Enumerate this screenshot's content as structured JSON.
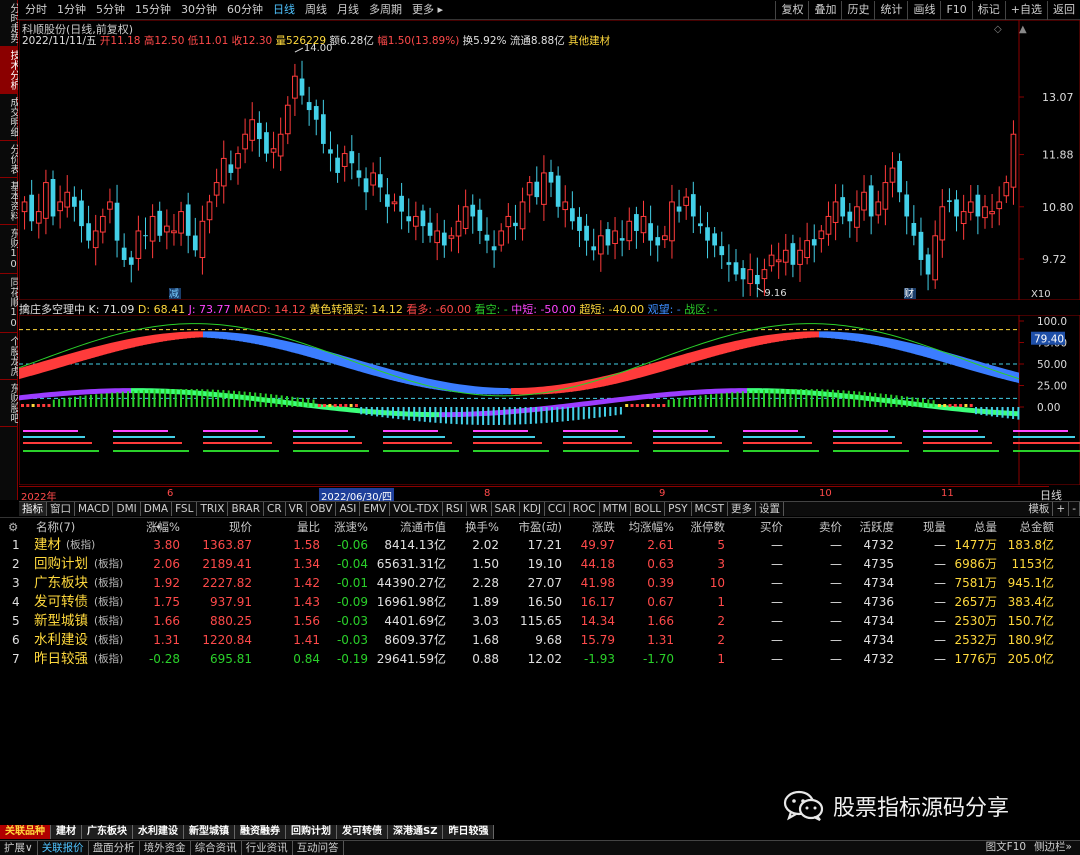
{
  "toolbar": {
    "periods": [
      "分时",
      "1分钟",
      "5分钟",
      "15分钟",
      "30分钟",
      "60分钟",
      "日线",
      "周线",
      "月线",
      "多周期",
      "更多 ▸"
    ],
    "active_period": "日线",
    "tools": [
      "复权",
      "叠加",
      "历史",
      "统计",
      "画线",
      "F10",
      "标记",
      "+自选",
      "返回"
    ]
  },
  "leftnav": [
    "分时走势",
    "技术分析",
    "成交明细",
    "分价表",
    "基本资料",
    "东财10",
    "同花顺10",
    "个股龙虎",
    "东财股吧"
  ],
  "leftnav_active": "技术分析",
  "stock": {
    "title": "科顺股份(日线,前复权)",
    "date": "2022/11/11/五",
    "open_label": "开",
    "open": "11.18",
    "high_label": "高",
    "high": "12.50",
    "low_label": "低",
    "low": "11.01",
    "close_label": "收",
    "close": "12.30",
    "volume_label": "量",
    "volume": "526229",
    "amount_label": "额",
    "amount": "6.28亿",
    "change_label": "幅",
    "change": "1.50(13.89%)",
    "turnover_label": "换",
    "turnover": "5.92%",
    "float_label": "流通",
    "float": "8.88亿",
    "sector": "其他建材"
  },
  "price_axis": [
    "13.07",
    "11.88",
    "10.80",
    "9.72"
  ],
  "price_marks": {
    "high": "14.00",
    "low": "9.16",
    "x10": "X10"
  },
  "chart_labels": {
    "jian": "减",
    "cai": "财"
  },
  "indicator": {
    "name": "擒庄多空理中",
    "k": "K: 71.09",
    "d": "D: 68.41",
    "j": "J: 73.77",
    "macd": "MACD: 14.12",
    "signal": "黄色转强买: 14.12",
    "kanduo": "看多: -60.00",
    "kankong": "看空: -",
    "zhongduan": "中短: -50.00",
    "chaoduan": "超短: -40.00",
    "guanwang": "观望: -",
    "zhanqu": "战区: -"
  },
  "ind_axis": [
    "100.0",
    "75.00",
    "50.00",
    "25.00",
    "0.00"
  ],
  "ind_current": "79.40",
  "date_axis": [
    "2022年",
    "6",
    "2022/06/30/四",
    "8",
    "9",
    "10",
    "11"
  ],
  "date_axis_right": "日线",
  "ind_tabs": [
    "指标",
    "窗口",
    "MACD",
    "DMI",
    "DMA",
    "FSL",
    "TRIX",
    "BRAR",
    "CR",
    "VR",
    "OBV",
    "ASI",
    "EMV",
    "VOL-TDX",
    "RSI",
    "WR",
    "SAR",
    "KDJ",
    "CCI",
    "ROC",
    "MTM",
    "BOLL",
    "PSY",
    "MCST",
    "更多",
    "设置"
  ],
  "ind_tabs_right": [
    "模板",
    "+",
    "-"
  ],
  "table": {
    "headers": [
      "名称(7)",
      "•",
      "涨幅%",
      "现价",
      "量比",
      "涨速%",
      "流通市值",
      "换手%",
      "市盈(动)",
      "涨跌",
      "均涨幅%",
      "涨停数",
      "买价",
      "卖价",
      "活跃度",
      "现量",
      "总量",
      "总金额"
    ],
    "rows": [
      [
        "1",
        "建材",
        "(板指)",
        "3.80",
        "1363.87",
        "1.58",
        "-0.06",
        "8414.13亿",
        "2.02",
        "17.21",
        "49.97",
        "2.61",
        "5",
        "—",
        "—",
        "4732",
        "—",
        "1477万",
        "183.8亿"
      ],
      [
        "2",
        "回购计划",
        "(板指)",
        "2.06",
        "2189.41",
        "1.34",
        "-0.04",
        "65631.31亿",
        "1.50",
        "19.10",
        "44.18",
        "0.63",
        "3",
        "—",
        "—",
        "4735",
        "—",
        "6986万",
        "1153亿"
      ],
      [
        "3",
        "广东板块",
        "(板指)",
        "1.92",
        "2227.82",
        "1.42",
        "-0.01",
        "44390.27亿",
        "2.28",
        "27.07",
        "41.98",
        "0.39",
        "10",
        "—",
        "—",
        "4734",
        "—",
        "7581万",
        "945.1亿"
      ],
      [
        "4",
        "发可转债",
        "(板指)",
        "1.75",
        "937.91",
        "1.43",
        "-0.09",
        "16961.98亿",
        "1.89",
        "16.50",
        "16.17",
        "0.67",
        "1",
        "—",
        "—",
        "4736",
        "—",
        "2657万",
        "383.4亿"
      ],
      [
        "5",
        "新型城镇",
        "(板指)",
        "1.66",
        "880.25",
        "1.56",
        "-0.03",
        "4401.69亿",
        "3.03",
        "115.65",
        "14.34",
        "1.66",
        "2",
        "—",
        "—",
        "4734",
        "—",
        "2530万",
        "150.7亿"
      ],
      [
        "6",
        "水利建设",
        "(板指)",
        "1.31",
        "1220.84",
        "1.41",
        "-0.03",
        "8609.37亿",
        "1.68",
        "9.68",
        "15.79",
        "1.31",
        "2",
        "—",
        "—",
        "4734",
        "—",
        "2532万",
        "180.9亿"
      ],
      [
        "7",
        "昨日较强",
        "(板指)",
        "-0.28",
        "695.81",
        "0.84",
        "-0.19",
        "29641.59亿",
        "0.88",
        "12.02",
        "-1.93",
        "-1.70",
        "1",
        "—",
        "—",
        "4732",
        "—",
        "1776万",
        "205.0亿"
      ]
    ]
  },
  "watermark": "股票指标源码分享",
  "block_tabs": [
    "关联品种",
    "建材",
    "广东板块",
    "水利建设",
    "新型城镇",
    "融资融券",
    "回购计划",
    "发可转债",
    "深港通SZ",
    "昨日较强"
  ],
  "status_tabs": [
    "扩展∨",
    "关联报价",
    "盘面分析",
    "境外资金",
    "综合资讯",
    "行业资讯",
    "互动问答"
  ],
  "status_right": [
    "图文F10",
    "侧边栏»"
  ],
  "colors": {
    "up": "#ff4a4a",
    "down": "#43d0e8",
    "volume": "#ffd93d",
    "accent": "#8b0000"
  }
}
